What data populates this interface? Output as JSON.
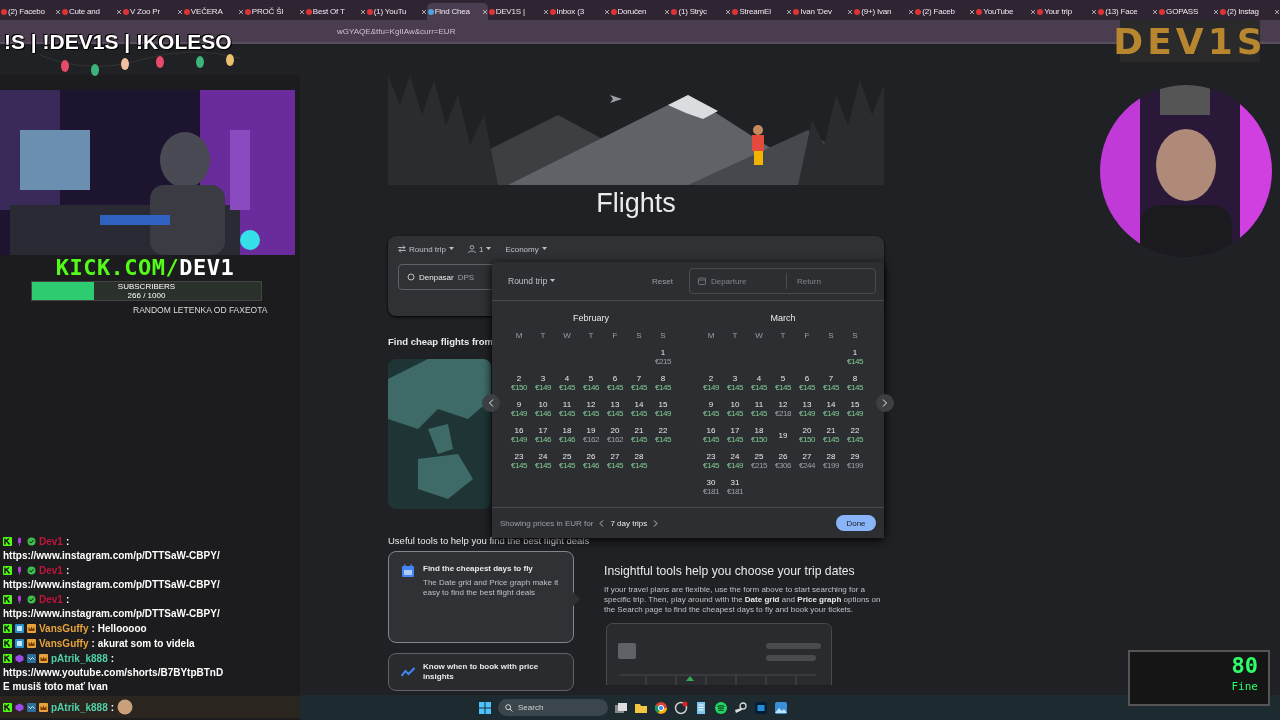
{
  "browser": {
    "tabs": [
      {
        "label": "(2) Facebo",
        "selected": false
      },
      {
        "label": "Cute and",
        "selected": false
      },
      {
        "label": "V Zoo Pr",
        "selected": false
      },
      {
        "label": "VEČERA",
        "selected": false
      },
      {
        "label": "PROČ ŠI",
        "selected": false
      },
      {
        "label": "Best Of T",
        "selected": false
      },
      {
        "label": "(1) YouTu",
        "selected": false
      },
      {
        "label": "Find Chea",
        "selected": true
      },
      {
        "label": "DEV1S |",
        "selected": false
      },
      {
        "label": "Inbox (3",
        "selected": false
      },
      {
        "label": "Doručen",
        "selected": false
      },
      {
        "label": "(1) Strýc",
        "selected": false
      },
      {
        "label": "StreamEl",
        "selected": false
      },
      {
        "label": "Ivan 'Dev",
        "selected": false
      },
      {
        "label": "(9+) Ivan",
        "selected": false
      },
      {
        "label": "(2) Faceb",
        "selected": false
      },
      {
        "label": "YouTube",
        "selected": false
      },
      {
        "label": "Your trip",
        "selected": false
      },
      {
        "label": "(13) Face",
        "selected": false
      },
      {
        "label": "GOPASS",
        "selected": false
      },
      {
        "label": "(2) Instag",
        "selected": false
      }
    ],
    "url": "wGYAQE&tfu=KgIIAw&curr=EUR"
  },
  "overlay": {
    "commands": "!S | !DEV1S | !KOLESO",
    "site": "KICK.COM/",
    "channel": "DEV1",
    "subscribers_label": "SUBSCRIBERS",
    "subscribers_count": "266 / 1000",
    "level": 0.27,
    "goal": "RANDOM LETENKA OD FAXEOTA",
    "logo": "DEV1S",
    "meter_value": "80",
    "meter_status": "Fine"
  },
  "chat": {
    "messages": [
      {
        "user": "Dev1",
        "colon": ":",
        "color": "#c0143c",
        "badges": [
          {
            "kind": "kick"
          },
          {
            "kind": "mic"
          },
          {
            "kind": "verified"
          }
        ],
        "lines": [
          "https://www.instagram.com/p/DTTSaW-CBPY/"
        ]
      },
      {
        "user": "Dev1",
        "colon": ":",
        "color": "#c0143c",
        "badges": [
          {
            "kind": "kick"
          },
          {
            "kind": "mic"
          },
          {
            "kind": "verified"
          }
        ],
        "lines": [
          "https://www.instagram.com/p/DTTSaW-CBPY/"
        ]
      },
      {
        "user": "Dev1",
        "colon": ":",
        "color": "#c0143c",
        "badges": [
          {
            "kind": "kick"
          },
          {
            "kind": "mic"
          },
          {
            "kind": "verified"
          }
        ],
        "lines": [
          "https://www.instagram.com/p/DTTSaW-CBPY/"
        ]
      },
      {
        "user": "VansGuffy",
        "colon": ":",
        "color": "#e8a33a",
        "badges": [
          {
            "kind": "kick"
          },
          {
            "kind": "sub"
          },
          {
            "kind": "crown"
          }
        ],
        "text": "Hellooooo"
      },
      {
        "user": "VansGuffy",
        "colon": ":",
        "color": "#e8a33a",
        "badges": [
          {
            "kind": "kick"
          },
          {
            "kind": "sub"
          },
          {
            "kind": "crown"
          }
        ],
        "text": "akurat som to videla"
      },
      {
        "user": "pAtrik_k888",
        "colon": ":",
        "color": "#4fd1a8",
        "badges": [
          {
            "kind": "kick"
          },
          {
            "kind": "gem"
          },
          {
            "kind": "wave"
          },
          {
            "kind": "crown"
          }
        ],
        "lines": [
          "https://www.youtube.com/shorts/B7BYtpBTnD",
          "E musiš toto mať Ivan"
        ]
      },
      {
        "user": "pAtrik_k888",
        "colon": ":",
        "color": "#4fd1a8",
        "badges": [
          {
            "kind": "kick"
          },
          {
            "kind": "gem"
          },
          {
            "kind": "wave"
          },
          {
            "kind": "crown"
          }
        ],
        "emote": true
      }
    ]
  },
  "flights": {
    "title": "Flights",
    "trip_type": "Round trip",
    "passengers": "1",
    "cabin": "Economy",
    "origin": "Denpasar",
    "origin_code": "DPS",
    "cheap_heading": "Find cheap flights from",
    "tools_heading": "Useful tools to help you find the best flight deals",
    "tool_cards": [
      {
        "title": "Find the cheapest days to fly",
        "text": "The Date grid and Price graph make it easy to find the best flight deals",
        "selected": true
      },
      {
        "title": "Know when to book with price insights",
        "selected": false
      }
    ],
    "insight_title": "Insightful tools help you choose your trip dates",
    "insight_text": "If your travel plans are flexible, use the form above to start searching for a specific trip. Then, play around with the **Date grid** and **Price graph** options on the Search page to find the cheapest days to fly and book your tickets."
  },
  "datepicker": {
    "trip_type": "Round trip",
    "reset": "Reset",
    "departure_placeholder": "Departure",
    "return_placeholder": "Return",
    "months": [
      {
        "name": "February",
        "weekdays": [
          "M",
          "T",
          "W",
          "T",
          "F",
          "S",
          "S"
        ],
        "weeks": [
          [
            {
              "kind": "blank"
            },
            {
              "kind": "blank"
            },
            {
              "kind": "blank"
            },
            {
              "kind": "blank"
            },
            {
              "kind": "blank"
            },
            {
              "kind": "blank"
            },
            {
              "kind": "day",
              "day": "1",
              "price": "€215",
              "low": false
            }
          ],
          [
            {
              "kind": "day",
              "day": "2",
              "price": "€150",
              "low": true
            },
            {
              "kind": "day",
              "day": "3",
              "price": "€149",
              "low": true
            },
            {
              "kind": "day",
              "day": "4",
              "price": "€145",
              "low": true
            },
            {
              "kind": "day",
              "day": "5",
              "price": "€146",
              "low": true
            },
            {
              "kind": "day",
              "day": "6",
              "price": "€145",
              "low": true
            },
            {
              "kind": "day",
              "day": "7",
              "price": "€145",
              "low": true
            },
            {
              "kind": "day",
              "day": "8",
              "price": "€145",
              "low": true
            }
          ],
          [
            {
              "kind": "day",
              "day": "9",
              "price": "€149",
              "low": true
            },
            {
              "kind": "day",
              "day": "10",
              "price": "€146",
              "low": true
            },
            {
              "kind": "day",
              "day": "11",
              "price": "€145",
              "low": true
            },
            {
              "kind": "day",
              "day": "12",
              "price": "€145",
              "low": true
            },
            {
              "kind": "day",
              "day": "13",
              "price": "€145",
              "low": true
            },
            {
              "kind": "day",
              "day": "14",
              "price": "€145",
              "low": true
            },
            {
              "kind": "day",
              "day": "15",
              "price": "€149",
              "low": true
            }
          ],
          [
            {
              "kind": "day",
              "day": "16",
              "price": "€149",
              "low": true
            },
            {
              "kind": "day",
              "day": "17",
              "price": "€146",
              "low": true
            },
            {
              "kind": "day",
              "day": "18",
              "price": "€146",
              "low": true
            },
            {
              "kind": "day",
              "day": "19",
              "price": "€162",
              "low": false
            },
            {
              "kind": "day",
              "day": "20",
              "price": "€162",
              "low": false
            },
            {
              "kind": "day",
              "day": "21",
              "price": "€145",
              "low": true
            },
            {
              "kind": "day",
              "day": "22",
              "price": "€145",
              "low": true
            }
          ],
          [
            {
              "kind": "day",
              "day": "23",
              "price": "€145",
              "low": true
            },
            {
              "kind": "day",
              "day": "24",
              "price": "€145",
              "low": true
            },
            {
              "kind": "day",
              "day": "25",
              "price": "€145",
              "low": true
            },
            {
              "kind": "day",
              "day": "26",
              "price": "€146",
              "low": true
            },
            {
              "kind": "day",
              "day": "27",
              "price": "€145",
              "low": true
            },
            {
              "kind": "day",
              "day": "28",
              "price": "€145",
              "low": true
            }
          ]
        ]
      },
      {
        "name": "March",
        "weekdays": [
          "M",
          "T",
          "W",
          "T",
          "F",
          "S",
          "S"
        ],
        "weeks": [
          [
            {
              "kind": "blank"
            },
            {
              "kind": "blank"
            },
            {
              "kind": "blank"
            },
            {
              "kind": "blank"
            },
            {
              "kind": "blank"
            },
            {
              "kind": "blank"
            },
            {
              "kind": "day",
              "day": "1",
              "price": "€145",
              "low": true
            }
          ],
          [
            {
              "kind": "day",
              "day": "2",
              "price": "€149",
              "low": true
            },
            {
              "kind": "day",
              "day": "3",
              "price": "€145",
              "low": true
            },
            {
              "kind": "day",
              "day": "4",
              "price": "€145",
              "low": true
            },
            {
              "kind": "day",
              "day": "5",
              "price": "€145",
              "low": true
            },
            {
              "kind": "day",
              "day": "6",
              "price": "€145",
              "low": true
            },
            {
              "kind": "day",
              "day": "7",
              "price": "€145",
              "low": true
            },
            {
              "kind": "day",
              "day": "8",
              "price": "€145",
              "low": true
            }
          ],
          [
            {
              "kind": "day",
              "day": "9",
              "price": "€145",
              "low": true
            },
            {
              "kind": "day",
              "day": "10",
              "price": "€145",
              "low": true
            },
            {
              "kind": "day",
              "day": "11",
              "price": "€145",
              "low": true
            },
            {
              "kind": "day",
              "day": "12",
              "price": "€218",
              "low": false
            },
            {
              "kind": "day",
              "day": "13",
              "price": "€149",
              "low": true
            },
            {
              "kind": "day",
              "day": "14",
              "price": "€149",
              "low": true
            },
            {
              "kind": "day",
              "day": "15",
              "price": "€149",
              "low": true
            }
          ],
          [
            {
              "kind": "day",
              "day": "16",
              "price": "€145",
              "low": true
            },
            {
              "kind": "day",
              "day": "17",
              "price": "€145",
              "low": true
            },
            {
              "kind": "day",
              "day": "18",
              "price": "€150",
              "low": true
            },
            {
              "kind": "day",
              "day": "19"
            },
            {
              "kind": "day",
              "day": "20",
              "price": "€150",
              "low": true
            },
            {
              "kind": "day",
              "day": "21",
              "price": "€145",
              "low": true
            },
            {
              "kind": "day",
              "day": "22",
              "price": "€145",
              "low": true
            }
          ],
          [
            {
              "kind": "day",
              "day": "23",
              "price": "€145",
              "low": true
            },
            {
              "kind": "day",
              "day": "24",
              "price": "€149",
              "low": true
            },
            {
              "kind": "day",
              "day": "25",
              "price": "€215",
              "low": false
            },
            {
              "kind": "day",
              "day": "26",
              "price": "€306",
              "low": false
            },
            {
              "kind": "day",
              "day": "27",
              "price": "€244",
              "low": false
            },
            {
              "kind": "day",
              "day": "28",
              "price": "€199",
              "low": false
            },
            {
              "kind": "day",
              "day": "29",
              "price": "€199",
              "low": false
            }
          ],
          [
            {
              "kind": "day",
              "day": "30",
              "price": "€181",
              "low": false
            },
            {
              "kind": "day",
              "day": "31",
              "price": "€181",
              "low": false
            }
          ]
        ]
      }
    ],
    "footer_text": "Showing prices in EUR for",
    "trip_length": "7 day trips",
    "done": "Done"
  },
  "taskbar": {
    "search": "Search"
  }
}
